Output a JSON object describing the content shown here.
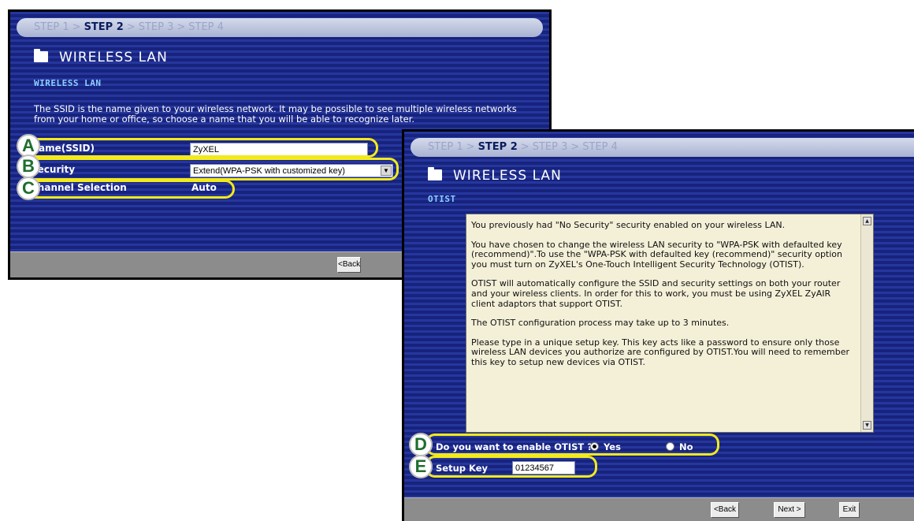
{
  "panel1": {
    "steps": [
      "STEP 1",
      "STEP 2",
      "STEP 3",
      "STEP 4"
    ],
    "current_step": "STEP 2",
    "title": "WIRELESS LAN",
    "section": "WIRELESS LAN",
    "description": "The SSID is the name given to your wireless network. It may be possible to see multiple wireless networks from your home or office, so choose a name that you will be able to recognize later.",
    "name_label": "Name(SSID)",
    "name_value": "ZyXEL",
    "security_label": "Security",
    "security_value": "Extend(WPA-PSK with customized key)",
    "channel_label": "Channel Selection",
    "channel_value": "Auto",
    "back_button": "<Back"
  },
  "panel2": {
    "steps": [
      "STEP 1",
      "STEP 2",
      "STEP 3",
      "STEP 4"
    ],
    "current_step": "STEP 2",
    "title": "WIRELESS LAN",
    "section": "OTIST",
    "paragraphs": [
      "You previously had \"No Security\" security enabled on your wireless LAN.",
      "You have chosen to change the wireless LAN security to \"WPA-PSK with defaulted key (recommend)\".To use the \"WPA-PSK with defaulted key (recommend)\" security option you must turn on ZyXEL's One-Touch Intelligent Security Technology (OTIST).",
      "OTIST will automatically configure the SSID and security settings on both your router and your wireless clients. In order for this to work, you must be using ZyXEL ZyAIR client adaptors that support OTIST.",
      "The OTIST configuration process may take up to 3 minutes.",
      "Please type in a unique setup key. This key acts like a password to ensure only those wireless LAN devices you authorize are configured by OTIST.You will need to remember this key to setup new devices via OTIST."
    ],
    "otist_question": "Do you want to enable OTIST ?",
    "yes_label": "Yes",
    "no_label": "No",
    "otist_selected": "Yes",
    "setup_key_label": "Setup Key",
    "setup_key_value": "01234567",
    "back_button": "<Back",
    "next_button": "Next >",
    "exit_button": "Exit"
  },
  "callouts": [
    "A",
    "B",
    "C",
    "D",
    "E"
  ],
  "colors": {
    "panel_bg": "#1c2a8c",
    "highlight": "#f2ea1c",
    "callout_letter": "#1f6e2e",
    "section_heading": "#8ed0ff",
    "textarea_bg": "#f4f0d8"
  }
}
